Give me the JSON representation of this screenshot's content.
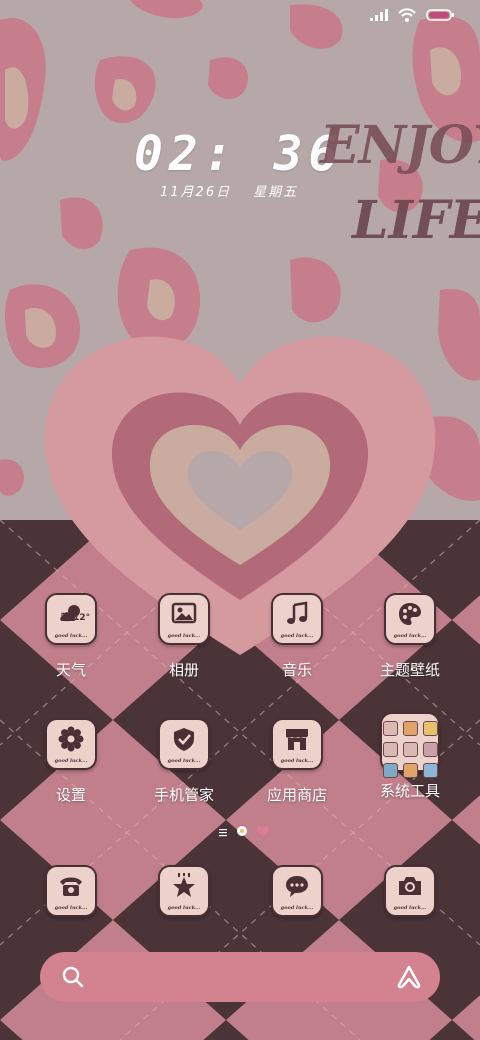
{
  "clock": {
    "time": "02: 36",
    "date": "11月26日",
    "weekday": "星期五"
  },
  "wallpaper": {
    "line1": "ENJOY",
    "line2": "LIFE"
  },
  "apps": [
    {
      "id": "weather",
      "label": "天气",
      "tag": "good luck...",
      "badge": "晴 12°",
      "icon": "weather-icon"
    },
    {
      "id": "gallery",
      "label": "相册",
      "tag": "good luck...",
      "icon": "photo-icon"
    },
    {
      "id": "music",
      "label": "音乐",
      "tag": "good luck...",
      "icon": "music-note-icon"
    },
    {
      "id": "themes",
      "label": "主题壁纸",
      "tag": "good luck...",
      "icon": "palette-icon"
    },
    {
      "id": "settings",
      "label": "设置",
      "tag": "good luck...",
      "icon": "gear-icon"
    },
    {
      "id": "security",
      "label": "手机管家",
      "tag": "good luck...",
      "icon": "shield-check-icon"
    },
    {
      "id": "store",
      "label": "应用商店",
      "tag": "good luck...",
      "icon": "store-icon"
    },
    {
      "id": "tools",
      "label": "系统工具",
      "icon": "folder-icon"
    }
  ],
  "dock": [
    {
      "id": "phone",
      "tag": "good luck...",
      "icon": "phone-icon"
    },
    {
      "id": "favorites",
      "tag": "good luck...",
      "icon": "star-icon"
    },
    {
      "id": "messages",
      "tag": "good luck...",
      "icon": "message-icon"
    },
    {
      "id": "camera",
      "tag": "good luck...",
      "icon": "camera-icon"
    }
  ],
  "colors": {
    "pink": "#d2838f",
    "dark": "#4a3035",
    "icon_bg": "#ecd2cb",
    "wall_grey": "#b6a8a9",
    "argyle_pink": "#c07f8a",
    "argyle_dark": "#4a3438"
  }
}
